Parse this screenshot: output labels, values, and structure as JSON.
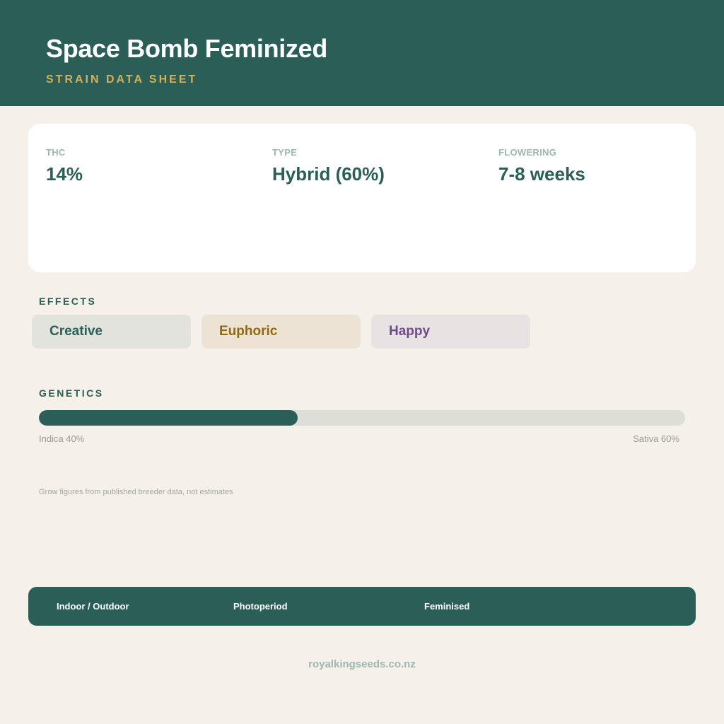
{
  "header": {
    "title": "Space Bomb Feminized",
    "subtitle": "STRAIN DATA SHEET"
  },
  "stats": [
    {
      "label": "THC",
      "value": "14%"
    },
    {
      "label": "TYPE",
      "value": "Hybrid (60%)"
    },
    {
      "label": "FLOWERING",
      "value": "7-8 weeks"
    }
  ],
  "effects": {
    "heading": "EFFECTS",
    "items": [
      "Creative",
      "Euphoric",
      "Happy"
    ]
  },
  "genetics": {
    "heading": "GENETICS",
    "indica_label": "Indica 40%",
    "sativa_label": "Sativa 60%",
    "indica_fraction": 0.4
  },
  "note": "Grow figures from published breeder data, not estimates",
  "footer": {
    "items": [
      "Indoor / Outdoor",
      "Photoperiod",
      "Feminised"
    ]
  },
  "site": "royalkingseeds.co.nz",
  "colors": {
    "primary": "#2a5e57",
    "accent": "#d3b15a",
    "background": "#f5f0ea"
  }
}
